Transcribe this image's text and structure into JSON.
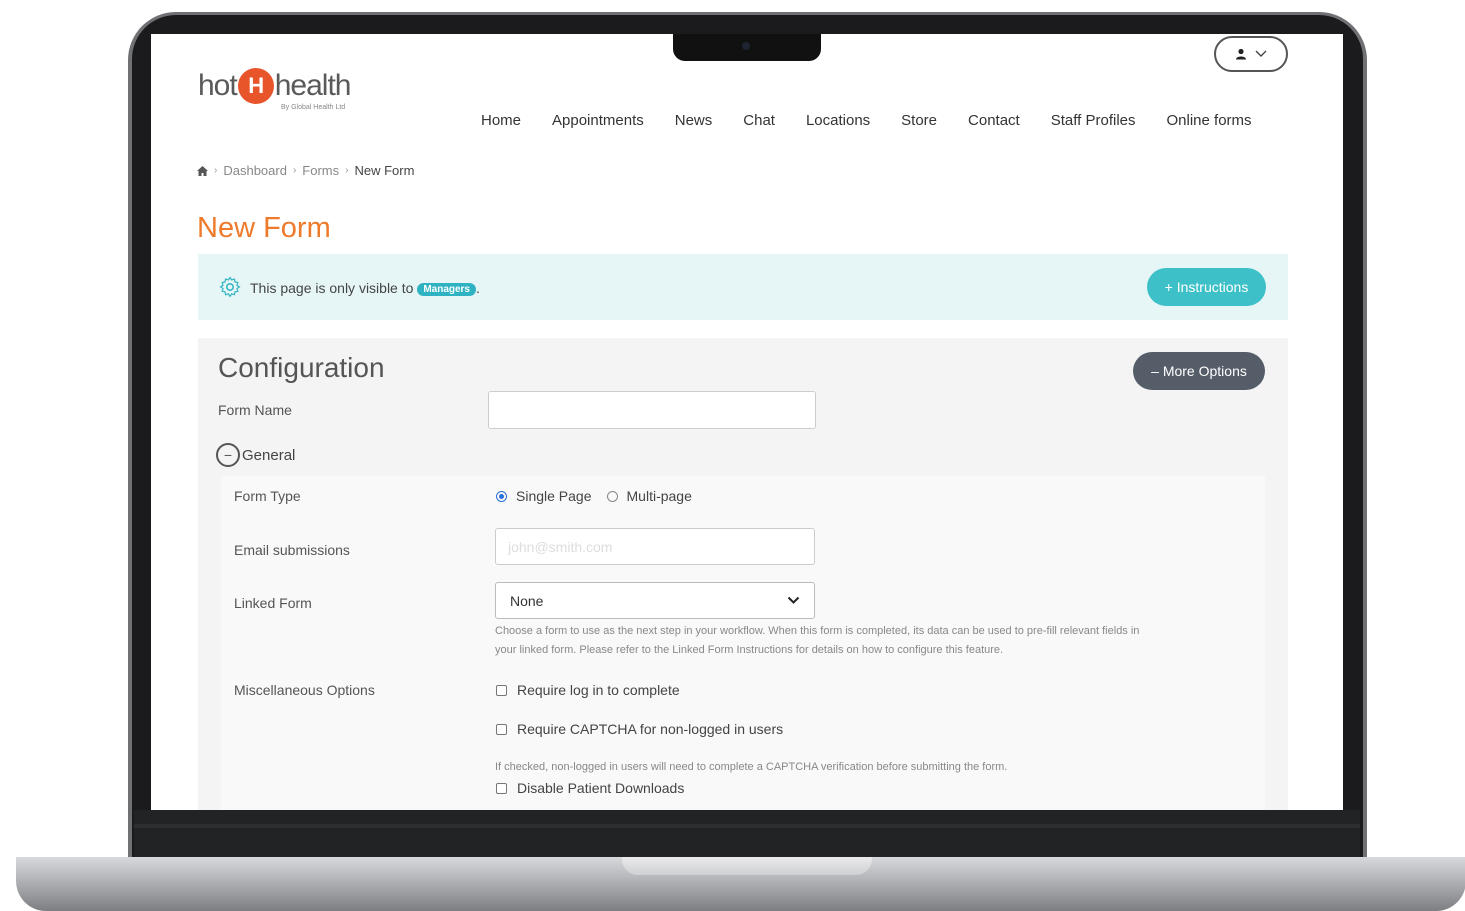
{
  "header": {
    "logo_left": "hot",
    "logo_mark": "H",
    "logo_right": "health",
    "logo_sub": "By Global Health Ltd",
    "user_menu_icon": "user-icon",
    "nav": [
      "Home",
      "Appointments",
      "News",
      "Chat",
      "Locations",
      "Store",
      "Contact",
      "Staff Profiles",
      "Online forms"
    ]
  },
  "breadcrumb": {
    "home_icon": "home-icon",
    "items": [
      "Dashboard",
      "Forms",
      "New Form"
    ]
  },
  "page": {
    "title": "New Form"
  },
  "banner": {
    "text": "This page is only visible to",
    "badge": "Managers",
    "suffix": ".",
    "instructions_button": "+ Instructions"
  },
  "config": {
    "title": "Configuration",
    "more_options_button": "– More Options",
    "form_name_label": "Form Name",
    "form_name_value": "",
    "general_label": "General",
    "form_type_label": "Form Type",
    "form_type_options": [
      "Single Page",
      "Multi-page"
    ],
    "form_type_selected": "Single Page",
    "email_label": "Email submissions",
    "email_placeholder": "john@smith.com",
    "linked_form_label": "Linked Form",
    "linked_form_value": "None",
    "linked_form_help_1": "Choose a form to use as the next step in your workflow. When this form is completed, its data can be used to pre-fill relevant fields in",
    "linked_form_help_2": "your linked form. Please refer to the Linked Form Instructions for details on how to configure this feature.",
    "misc_label": "Miscellaneous Options",
    "misc_options": [
      "Require log in to complete",
      "Require CAPTCHA for non-logged in users",
      "Disable Patient Downloads"
    ],
    "captcha_help": "If checked, non-logged in users will need to complete a CAPTCHA verification before submitting the form."
  },
  "colors": {
    "title_orange": "#ee7a2b",
    "teal": "#3ec0c8",
    "dark_button": "#555e68"
  }
}
